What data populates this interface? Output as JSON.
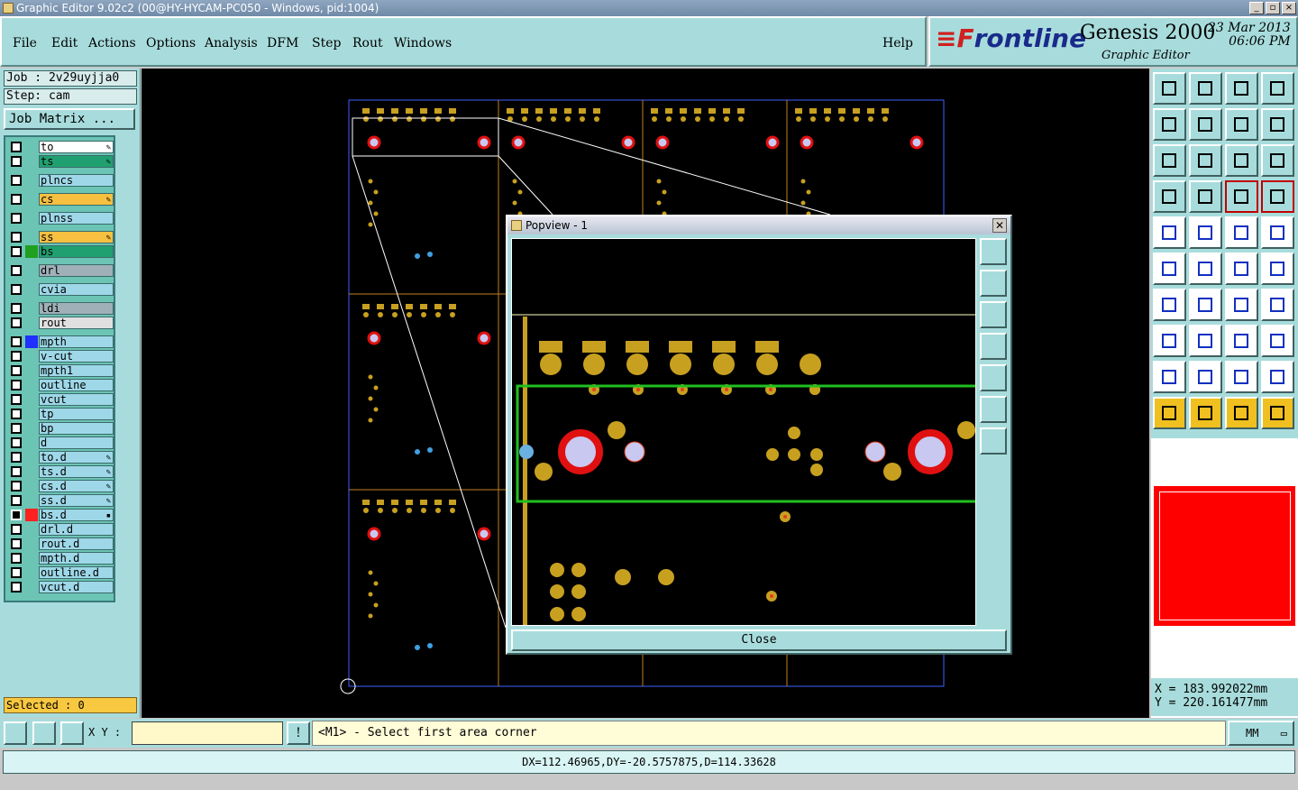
{
  "titlebar": {
    "title": "Graphic Editor 9.02c2 (00@HY-HYCAM-PC050 - Windows, pid:1004)"
  },
  "menu": [
    "File",
    "Edit",
    "Actions",
    "Options",
    "Analysis",
    "DFM",
    "Step",
    "Rout",
    "Windows"
  ],
  "help": "Help",
  "brand": {
    "logo_a": "≡F",
    "logo_b": "rontline",
    "product": "Genesis 2000",
    "subtitle": "Graphic Editor",
    "date": "23 Mar 2013",
    "time": "06:06 PM"
  },
  "job": {
    "job_label": "Job : 2v29uyjja0",
    "step_label": "Step: cam",
    "matrix_button": "Job Matrix ..."
  },
  "layers": [
    {
      "name": "to",
      "bg": "#ffffff",
      "mark": "✎"
    },
    {
      "name": "ts",
      "bg": "#20a070",
      "mark": "✎"
    },
    {
      "name": "plncs",
      "bg": "#9ed8e8",
      "mark": ""
    },
    {
      "name": "cs",
      "bg": "#f8c040",
      "mark": "✎"
    },
    {
      "name": "plnss",
      "bg": "#9ed8e8",
      "mark": ""
    },
    {
      "name": "ss",
      "bg": "#f8c040",
      "mark": "✎"
    },
    {
      "name": "bs",
      "bg": "#20a070",
      "mark": "",
      "swatch": "#20a020"
    },
    {
      "name": "drl",
      "bg": "#a0b0b8",
      "mark": ""
    },
    {
      "name": "cvia",
      "bg": "#9ed8e8",
      "mark": ""
    },
    {
      "name": "ldi",
      "bg": "#a0b0b8",
      "mark": ""
    },
    {
      "name": "rout",
      "bg": "#e0e0e0",
      "mark": ""
    },
    {
      "name": "mpth",
      "bg": "#9ed8e8",
      "mark": "",
      "swatch": "#2030ff"
    },
    {
      "name": "v-cut",
      "bg": "#9ed8e8",
      "mark": ""
    },
    {
      "name": "mpth1",
      "bg": "#9ed8e8",
      "mark": ""
    },
    {
      "name": "outline",
      "bg": "#9ed8e8",
      "mark": ""
    },
    {
      "name": "vcut",
      "bg": "#9ed8e8",
      "mark": ""
    },
    {
      "name": "tp",
      "bg": "#9ed8e8",
      "mark": ""
    },
    {
      "name": "bp",
      "bg": "#9ed8e8",
      "mark": ""
    },
    {
      "name": "d",
      "bg": "#9ed8e8",
      "mark": ""
    },
    {
      "name": "to.d",
      "bg": "#9ed8e8",
      "mark": "✎"
    },
    {
      "name": "ts.d",
      "bg": "#9ed8e8",
      "mark": "✎"
    },
    {
      "name": "cs.d",
      "bg": "#9ed8e8",
      "mark": "✎"
    },
    {
      "name": "ss.d",
      "bg": "#9ed8e8",
      "mark": "✎"
    },
    {
      "name": "bs.d",
      "bg": "#9ed8e8",
      "mark": "▪",
      "swatch": "#ff2020",
      "active": true
    },
    {
      "name": "drl.d",
      "bg": "#9ed8e8",
      "mark": ""
    },
    {
      "name": "rout.d",
      "bg": "#9ed8e8",
      "mark": ""
    },
    {
      "name": "mpth.d",
      "bg": "#9ed8e8",
      "mark": ""
    },
    {
      "name": "outline.d",
      "bg": "#9ed8e8",
      "mark": ""
    },
    {
      "name": "vcut.d",
      "bg": "#9ed8e8",
      "mark": ""
    }
  ],
  "selected": "Selected : 0",
  "coords": {
    "x": "X = 183.992022mm",
    "y": "Y = 220.161477mm"
  },
  "xy_label": "X Y :",
  "prompt": "<M1> - Select first area corner",
  "units": "MM",
  "status": "DX=112.46965,DY=-20.5757875,D=114.33628",
  "popview": {
    "title": "Popview - 1",
    "close_label": "Close"
  },
  "colors": {
    "pad": "#c8a020",
    "drill": "#c8c8f0",
    "ring": "#e01010",
    "panel_bg": "#a8dcdc",
    "zoom_box": "#20c020"
  }
}
